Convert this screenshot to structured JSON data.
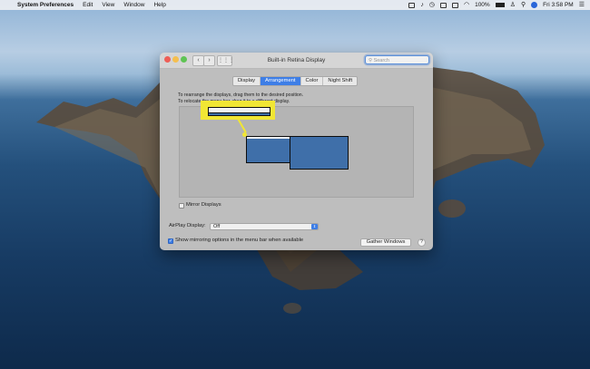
{
  "menubar": {
    "apple": "",
    "app": "System Preferences",
    "items": [
      "Edit",
      "View",
      "Window",
      "Help"
    ],
    "battery": "100%",
    "clock": "Fri 3:58 PM"
  },
  "window": {
    "title": "Built-in Retina Display",
    "search_placeholder": "Search",
    "tabs": [
      {
        "label": "Display"
      },
      {
        "label": "Arrangement"
      },
      {
        "label": "Color"
      },
      {
        "label": "Night Shift"
      }
    ],
    "active_tab": "Arrangement",
    "info_line1": "To rearrange the displays, drag them to the desired position.",
    "info_line2": "To relocate the menu bar, drag it to a different display.",
    "mirror_label": "Mirror Displays",
    "airplay_label": "AirPlay Display:",
    "airplay_value": "Off",
    "show_mirroring_label": "Show mirroring options in the menu bar when available",
    "show_mirroring_checked": true,
    "gather_button": "Gather Windows",
    "help_button": "?"
  },
  "colors": {
    "accent": "#3e7ee6",
    "highlight": "#f1e634",
    "display_fill": "#3f6fa9"
  }
}
